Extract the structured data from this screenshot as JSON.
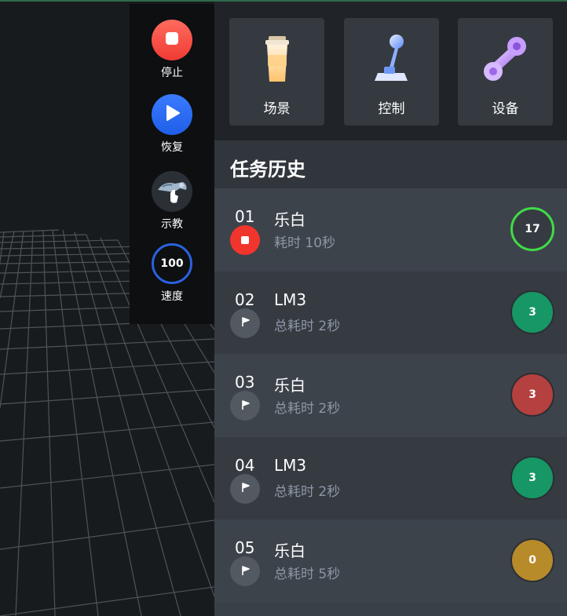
{
  "controls": {
    "stop": {
      "label": "停止",
      "icon": "stop-icon",
      "color": "#ef3b34"
    },
    "resume": {
      "label": "恢复",
      "icon": "play-icon",
      "color": "#1f5ee8"
    },
    "teach": {
      "label": "示教",
      "icon": "teach-icon"
    },
    "speed": {
      "label": "速度",
      "value": "100",
      "ring_color": "#2a62e0"
    }
  },
  "tiles": [
    {
      "label": "场景",
      "icon": "cup-icon"
    },
    {
      "label": "控制",
      "icon": "joystick-icon"
    },
    {
      "label": "设备",
      "icon": "wrench-icon"
    }
  ],
  "history": {
    "title": "任务历史",
    "tasks": [
      {
        "num": "01",
        "name": "乐白",
        "time": "耗时 10秒",
        "status": "running",
        "status_icon": "stop-icon",
        "count": "17",
        "count_style": "ring",
        "count_color": "#3fdc46"
      },
      {
        "num": "02",
        "name": "LM3",
        "time": "总耗时 2秒",
        "status": "done",
        "status_icon": "flag-icon",
        "count": "3",
        "count_style": "fill",
        "count_color": "#169765"
      },
      {
        "num": "03",
        "name": "乐白",
        "time": "总耗时 2秒",
        "status": "done",
        "status_icon": "flag-icon",
        "count": "3",
        "count_style": "fill",
        "count_color": "#b4403f"
      },
      {
        "num": "04",
        "name": "LM3",
        "time": "总耗时 2秒",
        "status": "done",
        "status_icon": "flag-icon",
        "count": "3",
        "count_style": "fill",
        "count_color": "#169765"
      },
      {
        "num": "05",
        "name": "乐白",
        "time": "总耗时 5秒",
        "status": "done",
        "status_icon": "flag-icon",
        "count": "0",
        "count_style": "fill",
        "count_color": "#b78a2a"
      }
    ]
  }
}
